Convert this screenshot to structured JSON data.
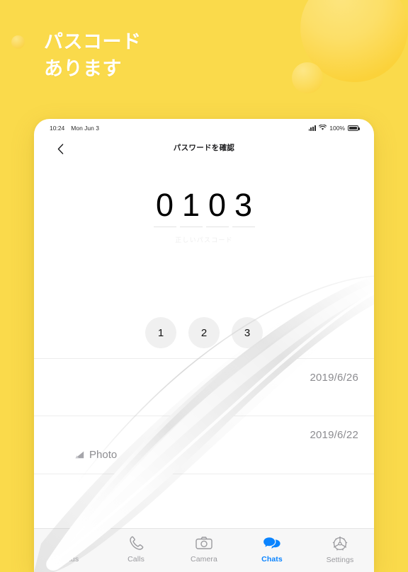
{
  "background": {
    "color": "#FADA4B",
    "decor": [
      {
        "name": "circle-large"
      },
      {
        "name": "circle-small"
      },
      {
        "name": "circle-tiny"
      }
    ]
  },
  "headline": {
    "text": "パスコード\nあります",
    "color": "#FFFFFF"
  },
  "device": {
    "status_bar": {
      "time": "10:24",
      "date": "Mon Jun 3",
      "signal_icon": "signal-bars-icon",
      "wifi_icon": "wifi-icon",
      "battery_percent": "100%",
      "battery_icon": "battery-icon"
    },
    "nav_bar": {
      "back_icon": "chevron-left-icon",
      "title": "パスワードを確認"
    },
    "passcode": {
      "digits": [
        "0",
        "1",
        "0",
        "3"
      ],
      "hint": "正しいパスコード",
      "hint_color": "#EEEEEE"
    },
    "keypad": {
      "keys": [
        "1",
        "2",
        "3"
      ]
    },
    "chat_list": {
      "rows": [
        {
          "date": "2019/6/26",
          "preview": "",
          "preview_icon": ""
        },
        {
          "date": "2019/6/22",
          "preview": "Photo",
          "preview_icon": "photo-icon"
        }
      ]
    },
    "tab_bar": {
      "active_color": "#0A84FF",
      "inactive_color": "#9A9A9E",
      "tabs": [
        {
          "label": "Status",
          "icon": "status-rings-icon",
          "active": false
        },
        {
          "label": "Calls",
          "icon": "phone-icon",
          "active": false
        },
        {
          "label": "Camera",
          "icon": "camera-icon",
          "active": false
        },
        {
          "label": "Chats",
          "icon": "chat-bubbles-icon",
          "active": true
        },
        {
          "label": "Settings",
          "icon": "gear-icon",
          "active": false
        }
      ]
    }
  }
}
